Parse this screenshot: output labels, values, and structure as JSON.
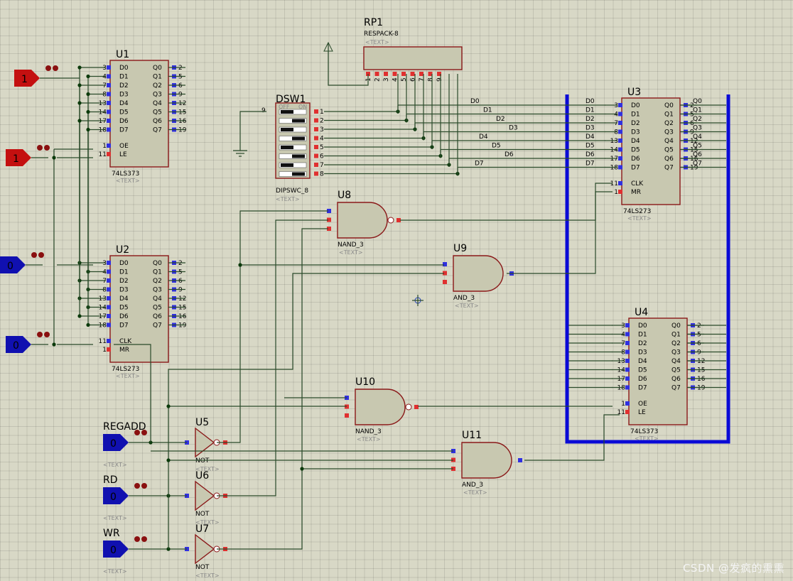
{
  "diagram": {
    "latches": [
      {
        "ref": "U1",
        "type": "74LS373",
        "ctrl": [
          "OE",
          "LE"
        ],
        "ctrl_pins": [
          "1",
          "11"
        ]
      },
      {
        "ref": "U2",
        "type": "74LS273",
        "ctrl": [
          "CLK",
          "MR"
        ],
        "ctrl_pins": [
          "11",
          "1"
        ]
      },
      {
        "ref": "U3",
        "type": "74LS273",
        "ctrl": [
          "CLK",
          "MR"
        ],
        "ctrl_pins": [
          "11",
          "1"
        ]
      },
      {
        "ref": "U4",
        "type": "74LS373",
        "ctrl": [
          "OE",
          "LE"
        ],
        "ctrl_pins": [
          "1",
          "11"
        ]
      }
    ],
    "d_labels": [
      "D0",
      "D1",
      "D2",
      "D3",
      "D4",
      "D5",
      "D6",
      "D7"
    ],
    "q_labels": [
      "Q0",
      "Q1",
      "Q2",
      "Q3",
      "Q4",
      "Q5",
      "Q6",
      "Q7"
    ],
    "in_pins": [
      "3",
      "4",
      "7",
      "8",
      "13",
      "14",
      "17",
      "18"
    ],
    "out_pins": [
      "2",
      "5",
      "6",
      "9",
      "12",
      "15",
      "16",
      "19"
    ],
    "respack": {
      "ref": "RP1",
      "type": "RESPACK-8",
      "pins": [
        "1",
        "2",
        "3",
        "4",
        "5",
        "6",
        "7",
        "8",
        "9"
      ]
    },
    "dipsw": {
      "ref": "DSW1",
      "type": "DIPSWC_8",
      "off": "OFF",
      "on": "ON",
      "com_pin": "9",
      "pins": [
        "1",
        "2",
        "3",
        "4",
        "5",
        "6",
        "7",
        "8"
      ]
    },
    "gates": [
      {
        "ref": "U8",
        "type": "NAND_3"
      },
      {
        "ref": "U9",
        "type": "AND_3"
      },
      {
        "ref": "U10",
        "type": "NAND_3"
      },
      {
        "ref": "U11",
        "type": "AND_3"
      },
      {
        "ref": "U5",
        "type": "NOT"
      },
      {
        "ref": "U6",
        "type": "NOT"
      },
      {
        "ref": "U7",
        "type": "NOT"
      }
    ],
    "inputs": [
      {
        "label": "",
        "value": "1"
      },
      {
        "label": "",
        "value": "1"
      },
      {
        "label": "",
        "value": "0"
      },
      {
        "label": "",
        "value": "0"
      },
      {
        "label": "REGADD",
        "value": "0"
      },
      {
        "label": "RD",
        "value": "0"
      },
      {
        "label": "WR",
        "value": "0"
      }
    ],
    "bus_labels": {
      "d": [
        "D0",
        "D1",
        "D2",
        "D3",
        "D4",
        "D5",
        "D6",
        "D7"
      ],
      "q": [
        "Q0",
        "Q1",
        "Q2",
        "Q3",
        "Q4",
        "Q5",
        "Q6",
        "Q7"
      ],
      "u3_in": [
        "D0",
        "D1",
        "D2",
        "D3",
        "D4",
        "D5",
        "D6",
        "D7"
      ],
      "u3_pin_text": [
        "3",
        "4",
        "7",
        "8",
        "13",
        "14",
        "17",
        "18"
      ]
    },
    "text_placeholder": "<TEXT>"
  },
  "watermark": "CSDN @发疯的熏熏",
  "colors": {
    "bus": "#0a0ad6",
    "wire": "#2a4a2a",
    "chip": "#c8c8b0",
    "pin_hi": "#e03030",
    "pin_lo": "#3030e0",
    "logic1": "#c41010",
    "logic0": "#1010b0"
  }
}
